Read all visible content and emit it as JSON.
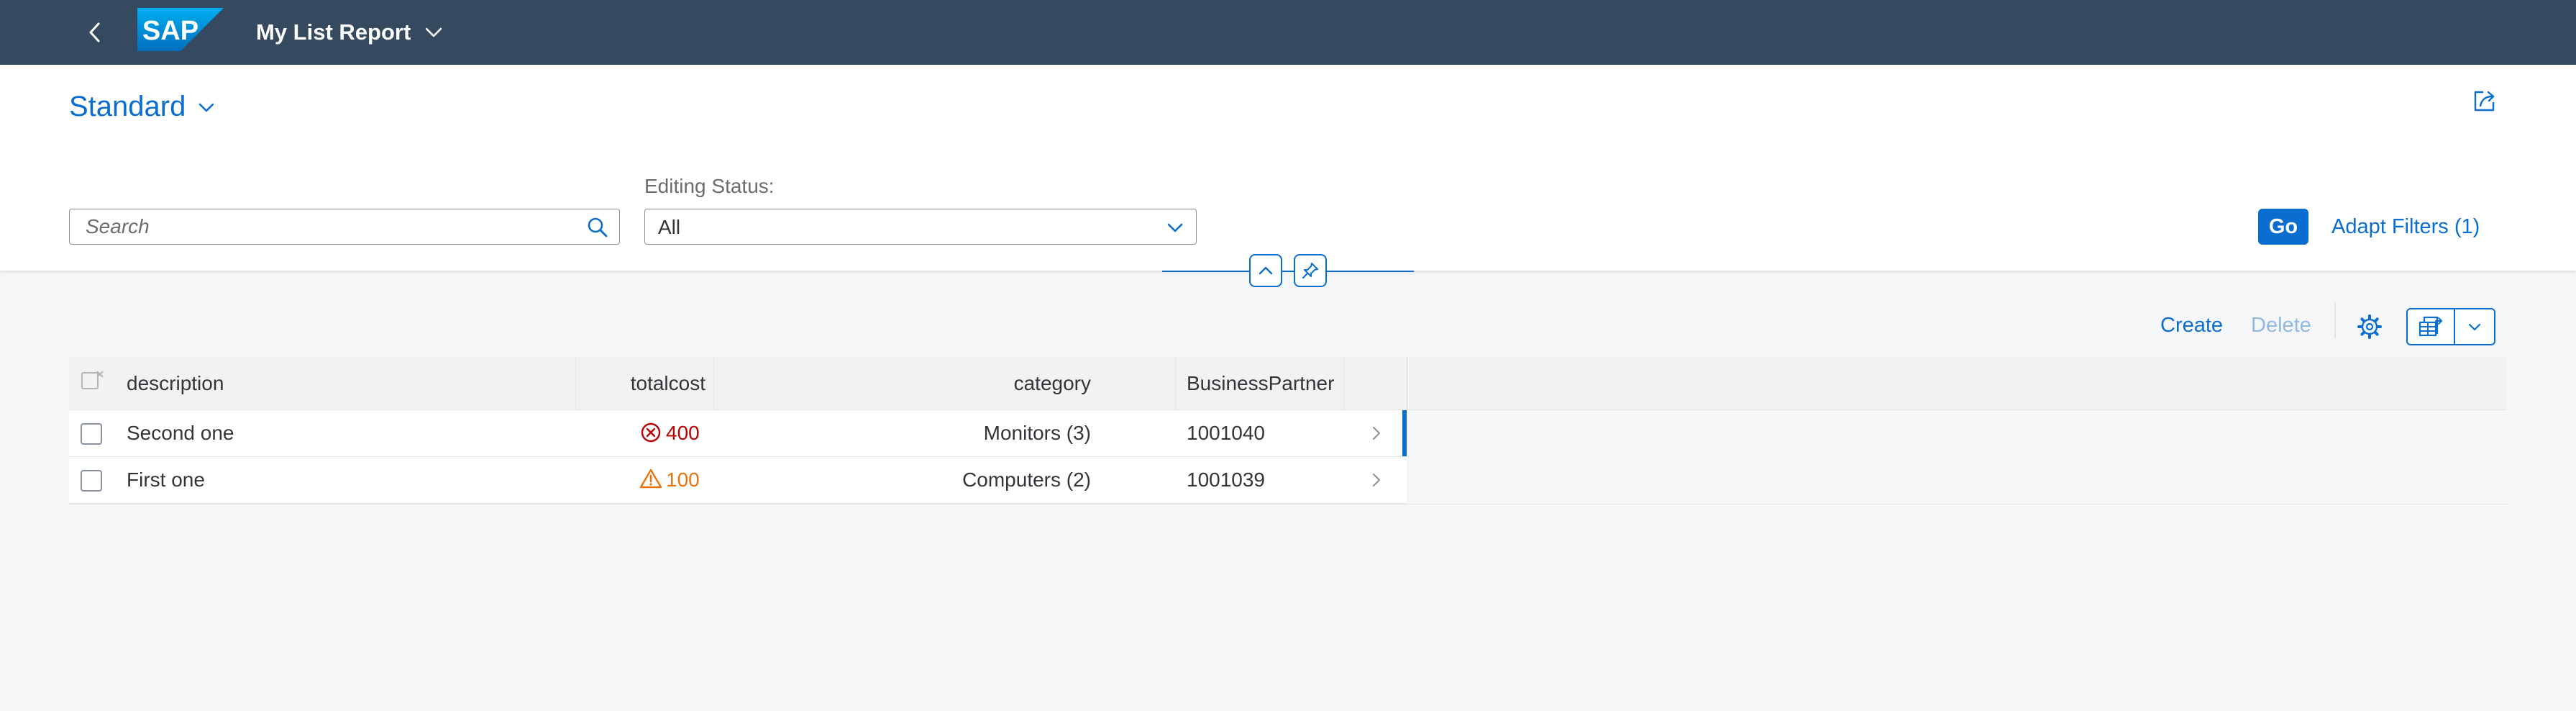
{
  "shell": {
    "title": "My List Report",
    "logo_text": "SAP",
    "colors": {
      "bar": "#354a5f",
      "logo": "#0a6ed1"
    }
  },
  "header": {
    "variant_name": "Standard",
    "search": {
      "placeholder": "Search",
      "value": ""
    },
    "editing_status": {
      "label": "Editing Status:",
      "value": "All"
    },
    "go_label": "Go",
    "adapt_filters_label": "Adapt Filters (1)"
  },
  "toolbar": {
    "create_label": "Create",
    "delete_label": "Delete"
  },
  "table": {
    "columns": [
      "description",
      "totalcost",
      "category",
      "BusinessPartner"
    ],
    "rows": [
      {
        "description": "Second one",
        "totalcost": "400",
        "status": "error",
        "category": "Monitors (3)",
        "business_partner": "1001040"
      },
      {
        "description": "First one",
        "totalcost": "100",
        "status": "warning",
        "category": "Computers (2)",
        "business_partner": "1001039"
      }
    ]
  },
  "colors": {
    "accent": "#0a6ed1",
    "error": "#bb0000",
    "warning": "#e9730c",
    "disabled_link": "#92b9e0"
  }
}
